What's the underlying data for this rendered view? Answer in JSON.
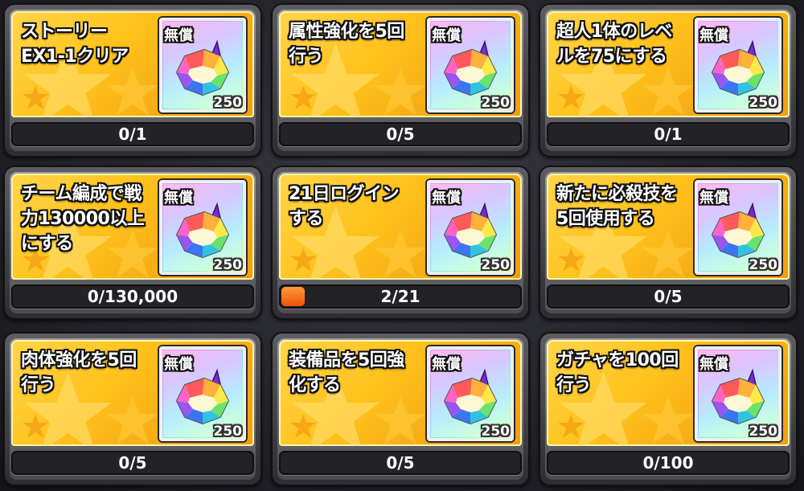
{
  "reward_label": "無償",
  "missions": [
    {
      "title": "ストーリー\nEX1-1クリア",
      "reward_amount": "250",
      "progress_text": "0/1",
      "progress_fraction": 0
    },
    {
      "title": "属性強化を5回\n行う",
      "reward_amount": "250",
      "progress_text": "0/5",
      "progress_fraction": 0
    },
    {
      "title": "超人1体のレベ\nルを75にする",
      "reward_amount": "250",
      "progress_text": "0/1",
      "progress_fraction": 0
    },
    {
      "title": "チーム編成で戦\n力130000以上\nにする",
      "reward_amount": "250",
      "progress_text": "0/130,000",
      "progress_fraction": 0
    },
    {
      "title": "21日ログイン\nする",
      "reward_amount": "250",
      "progress_text": "2/21",
      "progress_fraction": 0.095
    },
    {
      "title": "新たに必殺技を\n5回使用する",
      "reward_amount": "250",
      "progress_text": "0/5",
      "progress_fraction": 0
    },
    {
      "title": "肉体強化を5回\n行う",
      "reward_amount": "250",
      "progress_text": "0/5",
      "progress_fraction": 0
    },
    {
      "title": "装備品を5回強\n化する",
      "reward_amount": "250",
      "progress_text": "0/5",
      "progress_fraction": 0
    },
    {
      "title": "ガチャを100回\n行う",
      "reward_amount": "250",
      "progress_text": "0/100",
      "progress_fraction": 0
    }
  ],
  "colors": {
    "panel_gold": "#ffc21c",
    "progress_fill": "#f0510a",
    "progress_track": "#232327"
  },
  "icons": {
    "reward_item": "rainbow-gem-icon"
  }
}
